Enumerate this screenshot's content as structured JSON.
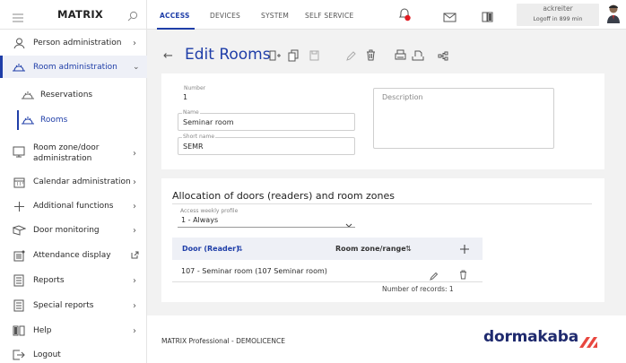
{
  "app": {
    "title": "MATRIX"
  },
  "tabs": [
    "ACCESS",
    "DEVICES",
    "SYSTEM",
    "SELF SERVICE"
  ],
  "user": {
    "name": "ackreiter",
    "logoff": "Logoff in 899 min"
  },
  "sidebar": {
    "items": [
      {
        "label": "Person administration",
        "icon": "person-icon"
      },
      {
        "label": "Room administration",
        "icon": "room-icon"
      },
      {
        "label": "Reservations",
        "icon": "reservations-icon"
      },
      {
        "label": "Rooms",
        "icon": "rooms-icon"
      },
      {
        "label": "Room zone/door administration",
        "icon": "door-icon"
      },
      {
        "label": "Calendar administration",
        "icon": "calendar-icon"
      },
      {
        "label": "Additional functions",
        "icon": "plus-icon"
      },
      {
        "label": "Door monitoring",
        "icon": "door-monitoring-icon"
      },
      {
        "label": "Attendance display",
        "icon": "attendance-icon"
      },
      {
        "label": "Reports",
        "icon": "report-icon"
      },
      {
        "label": "Special reports",
        "icon": "report-icon"
      },
      {
        "label": "Help",
        "icon": "help-icon"
      },
      {
        "label": "Logout",
        "icon": "logout-icon"
      }
    ]
  },
  "page": {
    "title": "Edit Rooms"
  },
  "form": {
    "number_label": "Number",
    "number_value": "1",
    "name_label": "Name",
    "name_value": "Seminar room",
    "short_label": "Short name",
    "short_value": "SEMR",
    "description_placeholder": "Description"
  },
  "allocation": {
    "title": "Allocation of doors (readers) and room zones",
    "profile_label": "Access weekly profile",
    "profile_value": "1 - Always",
    "col_door": "Door (Reader)",
    "col_zone": "Room zone/range",
    "rows": [
      {
        "door": "107 - Seminar room (107 Seminar room)",
        "zone": ""
      }
    ],
    "records": "Number of records: 1"
  },
  "footer": {
    "product": "MATRIX Professional - DEMOLICENCE",
    "brand": "dormakaba"
  },
  "colors": {
    "accent": "#1f3ea8",
    "brand": "#1f2a6e",
    "brand_logo": "#e8473f",
    "notification": "#e11b22"
  }
}
